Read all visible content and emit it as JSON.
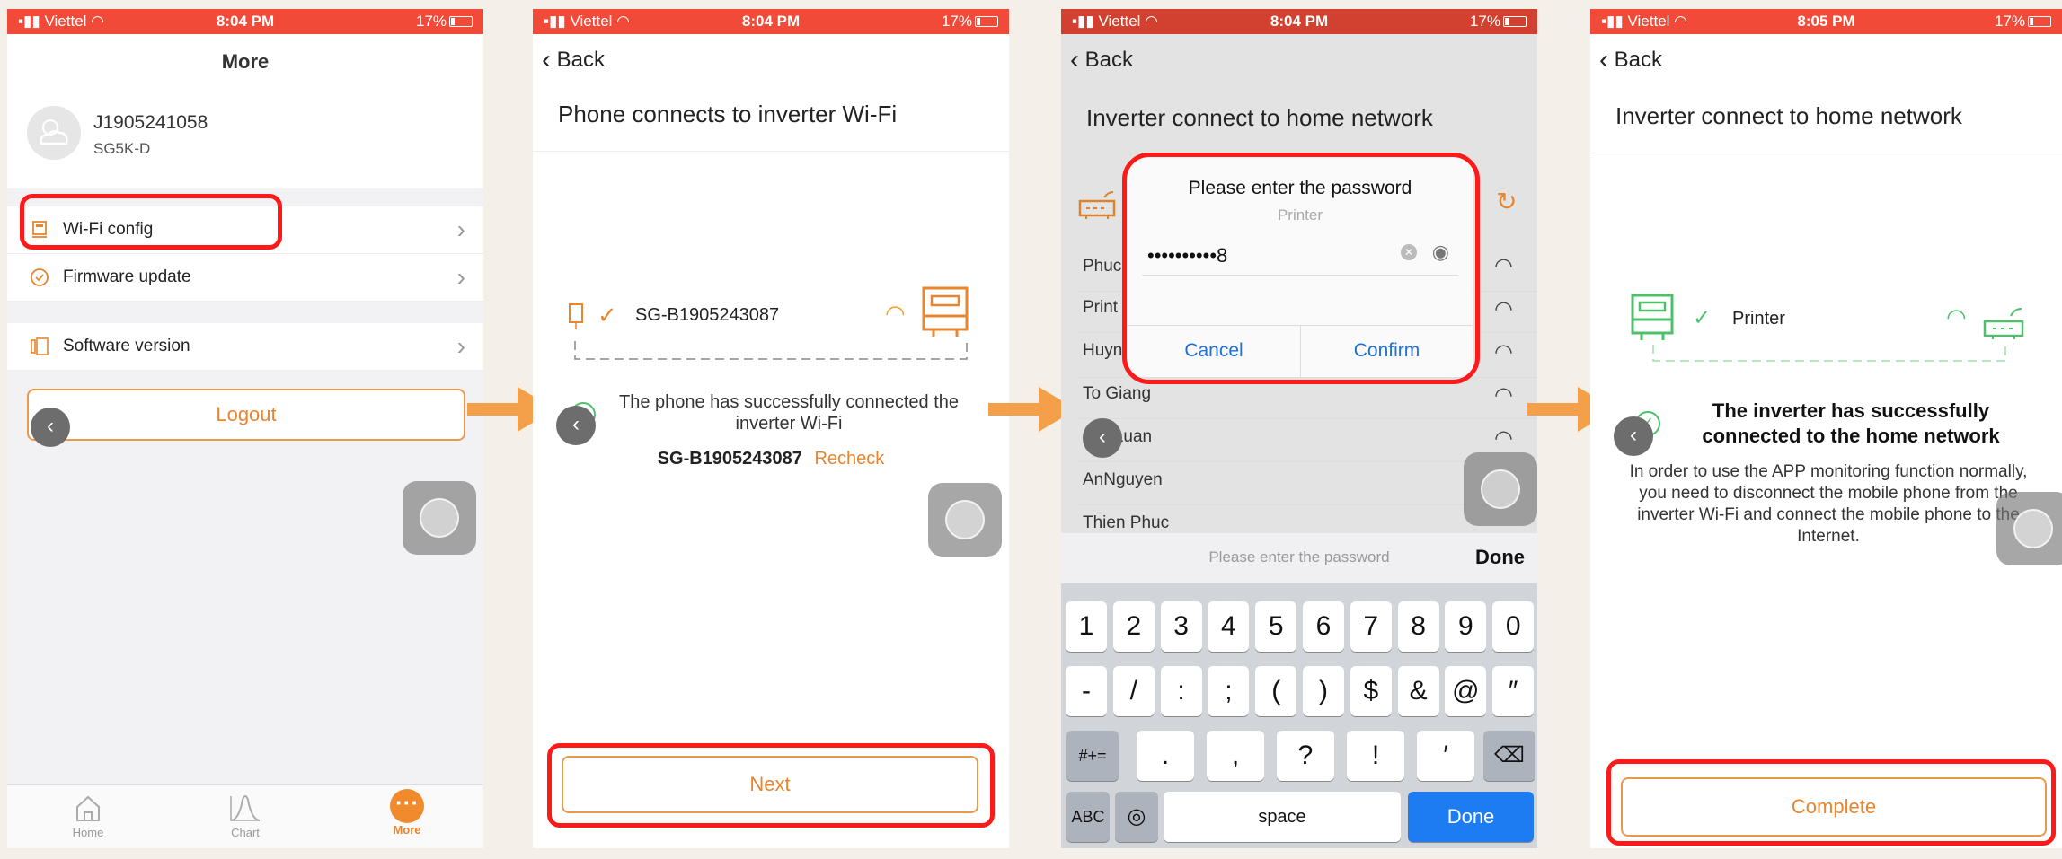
{
  "status_bar": {
    "p1": {
      "carrier": "Viettel",
      "time": "8:04 PM",
      "battery": "17%"
    },
    "p2": {
      "carrier": "Viettel",
      "time": "8:04 PM",
      "battery": "17%"
    },
    "p3": {
      "carrier": "Viettel",
      "time": "8:04 PM",
      "battery": "17%"
    },
    "p4": {
      "carrier": "Viettel",
      "time": "8:05 PM",
      "battery": "17%"
    }
  },
  "screen1": {
    "title": "More",
    "device_id": "J1905241058",
    "device_model": "SG5K-D",
    "menu": [
      {
        "label": "Wi-Fi config",
        "icon": "router-icon"
      },
      {
        "label": "Firmware update",
        "icon": "update-icon"
      },
      {
        "label": "Software version",
        "icon": "version-icon"
      }
    ],
    "logout_label": "Logout",
    "tabs": [
      {
        "label": "Home",
        "icon": "home-icon"
      },
      {
        "label": "Chart",
        "icon": "chart-icon"
      },
      {
        "label": "More",
        "icon": "more-icon"
      }
    ],
    "colors": {
      "accent": "#e8852f",
      "highlight": "#ff1a1a"
    }
  },
  "screen2": {
    "back_label": "Back",
    "title": "Phone connects to inverter Wi-Fi",
    "ssid": "SG-B1905243087",
    "message": "The phone has successfully connected the inverter Wi-Fi",
    "connected_ssid": "SG-B1905243087",
    "recheck_label": "Recheck",
    "next_label": "Next"
  },
  "screen3": {
    "back_label": "Back",
    "title": "Inverter connect to home network",
    "networks": [
      "Phuc",
      "Print",
      "Huyn",
      "To Giang",
      "Gia Luan",
      "AnNguyen",
      "Thien Phuc"
    ],
    "dialog": {
      "title": "Please enter the password",
      "network": "Printer",
      "password_value": "••••••••••8",
      "cancel_label": "Cancel",
      "confirm_label": "Confirm"
    },
    "keyboard": {
      "hint": "Please enter the password",
      "done_top": "Done",
      "row1": [
        "1",
        "2",
        "3",
        "4",
        "5",
        "6",
        "7",
        "8",
        "9",
        "0"
      ],
      "row2": [
        "-",
        "/",
        ":",
        ";",
        "(",
        ")",
        "$",
        "&",
        "@",
        "″"
      ],
      "row3_left": "#+=",
      "row3": [
        ".",
        ",",
        "?",
        "!",
        "′"
      ],
      "abc": "ABC",
      "space": "space",
      "done": "Done"
    }
  },
  "screen4": {
    "back_label": "Back",
    "title": "Inverter connect to home network",
    "network": "Printer",
    "headline": "The inverter has successfully connected to the home network",
    "body": "In order to use the APP monitoring function normally, you need to disconnect the mobile phone from the inverter Wi-Fi and connect the mobile phone to the Internet.",
    "complete_label": "Complete"
  }
}
